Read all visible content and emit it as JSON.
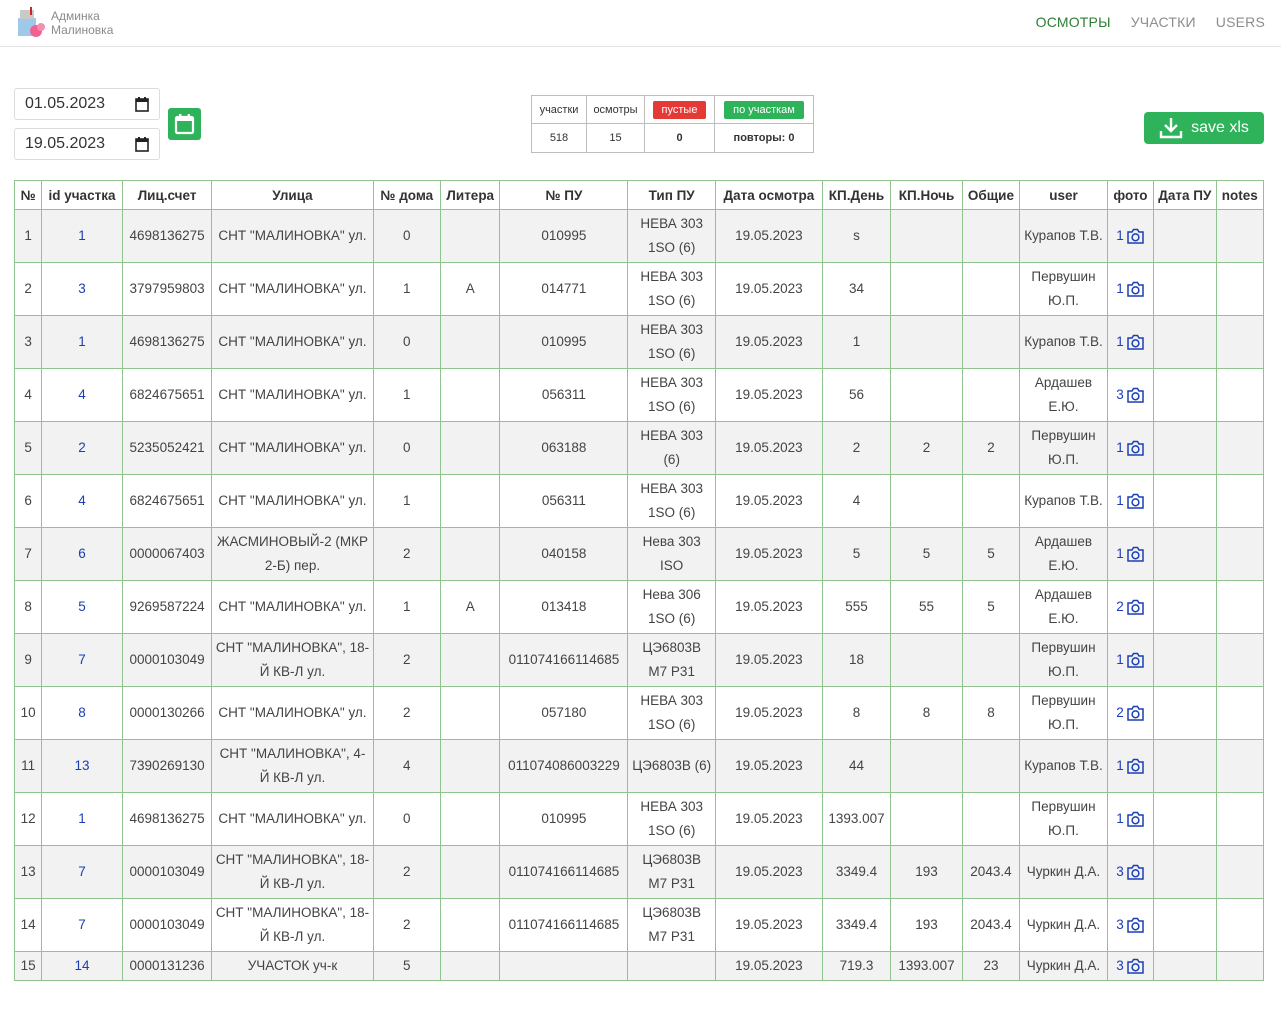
{
  "brand": {
    "line1": "Админка",
    "line2": "Малиновка"
  },
  "nav": [
    {
      "label": "ОСМОТРЫ",
      "active": true
    },
    {
      "label": "УЧАСТКИ",
      "active": false
    },
    {
      "label": "USERS",
      "active": false
    }
  ],
  "filters": {
    "date_from": "01.05.2023",
    "date_to": "19.05.2023"
  },
  "stats": {
    "headers": [
      "участки",
      "осмотры"
    ],
    "empty_label": "пустые",
    "by_plots_label": "по участкам",
    "values": [
      "518",
      "15",
      "0"
    ],
    "repeats": "повторы: 0"
  },
  "save_label": "save xls",
  "colors": {
    "accent": "#2fb35a",
    "nav_active": "#2e7d32",
    "danger": "#e53935",
    "link": "#1a3fb4",
    "border": "#8fc48f"
  },
  "table": {
    "headers": [
      "№",
      "id участка",
      "Лиц.счет",
      "Улица",
      "№ дома",
      "Литера",
      "№ ПУ",
      "Тип ПУ",
      "Дата осмотра",
      "КП.День",
      "КП.Ночь",
      "Общие",
      "user",
      "фото",
      "Дата ПУ",
      "notes"
    ],
    "rows": [
      [
        "1",
        "1",
        "4698136275",
        "СНТ \"МАЛИНОВКА\" ул.",
        "0",
        "",
        "010995",
        "НЕВА 303 1SO (6)",
        "19.05.2023",
        "s",
        "",
        "",
        "Курапов Т.В.",
        "1",
        "",
        ""
      ],
      [
        "2",
        "3",
        "3797959803",
        "СНТ \"МАЛИНОВКА\" ул.",
        "1",
        "А",
        "014771",
        "НЕВА 303 1SO (6)",
        "19.05.2023",
        "34",
        "",
        "",
        "Первушин Ю.П.",
        "1",
        "",
        ""
      ],
      [
        "3",
        "1",
        "4698136275",
        "СНТ \"МАЛИНОВКА\" ул.",
        "0",
        "",
        "010995",
        "НЕВА 303 1SO (6)",
        "19.05.2023",
        "1",
        "",
        "",
        "Курапов Т.В.",
        "1",
        "",
        ""
      ],
      [
        "4",
        "4",
        "6824675651",
        "СНТ \"МАЛИНОВКА\" ул.",
        "1",
        "",
        "056311",
        "НЕВА 303 1SO (6)",
        "19.05.2023",
        "56",
        "",
        "",
        "Ардашев Е.Ю.",
        "3",
        "",
        ""
      ],
      [
        "5",
        "2",
        "5235052421",
        "СНТ \"МАЛИНОВКА\" ул.",
        "0",
        "",
        "063188",
        "НЕВА 303 (6)",
        "19.05.2023",
        "2",
        "2",
        "2",
        "Первушин Ю.П.",
        "1",
        "",
        ""
      ],
      [
        "6",
        "4",
        "6824675651",
        "СНТ \"МАЛИНОВКА\" ул.",
        "1",
        "",
        "056311",
        "НЕВА 303 1SO (6)",
        "19.05.2023",
        "4",
        "",
        "",
        "Курапов Т.В.",
        "1",
        "",
        ""
      ],
      [
        "7",
        "6",
        "0000067403",
        "ЖАСМИНОВЫЙ-2 (МКР 2-Б) пер.",
        "2",
        "",
        "040158",
        "Нева 303 ISO",
        "19.05.2023",
        "5",
        "5",
        "5",
        "Ардашев Е.Ю.",
        "1",
        "",
        ""
      ],
      [
        "8",
        "5",
        "9269587224",
        "СНТ \"МАЛИНОВКА\" ул.",
        "1",
        "А",
        "013418",
        "Нева 306 1SO (6)",
        "19.05.2023",
        "555",
        "55",
        "5",
        "Ардашев Е.Ю.",
        "2",
        "",
        ""
      ],
      [
        "9",
        "7",
        "0000103049",
        "СНТ \"МАЛИНОВКА\", 18-Й КВ-Л ул.",
        "2",
        "",
        "011074166114685",
        "ЦЭ6803В М7 Р31",
        "19.05.2023",
        "18",
        "",
        "",
        "Первушин Ю.П.",
        "1",
        "",
        ""
      ],
      [
        "10",
        "8",
        "0000130266",
        "СНТ \"МАЛИНОВКА\" ул.",
        "2",
        "",
        "057180",
        "НЕВА 303 1SO (6)",
        "19.05.2023",
        "8",
        "8",
        "8",
        "Первушин Ю.П.",
        "2",
        "",
        ""
      ],
      [
        "11",
        "13",
        "7390269130",
        "СНТ \"МАЛИНОВКА\", 4-Й КВ-Л ул.",
        "4",
        "",
        "011074086003229",
        "ЦЭ6803В (6)",
        "19.05.2023",
        "44",
        "",
        "",
        "Курапов Т.В.",
        "1",
        "",
        ""
      ],
      [
        "12",
        "1",
        "4698136275",
        "СНТ \"МАЛИНОВКА\" ул.",
        "0",
        "",
        "010995",
        "НЕВА 303 1SO (6)",
        "19.05.2023",
        "1393.007",
        "",
        "",
        "Первушин Ю.П.",
        "1",
        "",
        ""
      ],
      [
        "13",
        "7",
        "0000103049",
        "СНТ \"МАЛИНОВКА\", 18-Й КВ-Л ул.",
        "2",
        "",
        "011074166114685",
        "ЦЭ6803В М7 Р31",
        "19.05.2023",
        "3349.4",
        "193",
        "2043.4",
        "Чуркин Д.А.",
        "3",
        "",
        ""
      ],
      [
        "14",
        "7",
        "0000103049",
        "СНТ \"МАЛИНОВКА\", 18-Й КВ-Л ул.",
        "2",
        "",
        "011074166114685",
        "ЦЭ6803В М7 Р31",
        "19.05.2023",
        "3349.4",
        "193",
        "2043.4",
        "Чуркин Д.А.",
        "3",
        "",
        ""
      ],
      [
        "15",
        "14",
        "0000131236",
        "УЧАСТОК уч-к",
        "5",
        "",
        "",
        "",
        "19.05.2023",
        "719.3",
        "1393.007",
        "23",
        "Чуркин Д.А.",
        "3",
        "",
        ""
      ]
    ]
  }
}
